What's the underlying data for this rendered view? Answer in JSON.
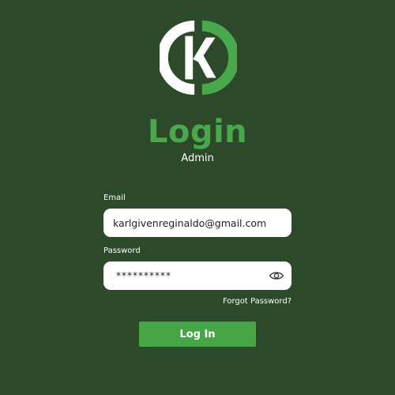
{
  "header": {
    "title": "Login",
    "subtitle": "Admin"
  },
  "logo": {
    "icon": "k-logo-icon",
    "letter": "K"
  },
  "form": {
    "email_label": "Email",
    "email_value": "karlgivenreginaldo@gmail.com",
    "password_label": "Password",
    "password_value": "**********",
    "password_toggle_icon": "eye-icon",
    "forgot_label": "Forgot Password?",
    "submit_label": "Log In"
  },
  "colors": {
    "background": "#2c4a2a",
    "accent": "#49a84c",
    "button": "#46a547",
    "text": "#ffffff",
    "field": "#ffffff"
  }
}
